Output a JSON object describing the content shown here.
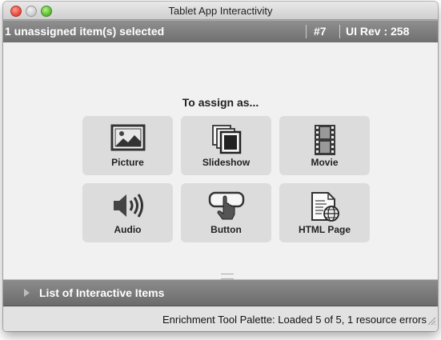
{
  "window": {
    "title": "Tablet App Interactivity"
  },
  "header": {
    "selection_text": "1 unassigned item(s) selected",
    "item_number": "#7",
    "ui_rev": "UI Rev : 258"
  },
  "assign": {
    "title": "To assign as...",
    "options": [
      {
        "label": "Picture",
        "icon": "picture-icon"
      },
      {
        "label": "Slideshow",
        "icon": "slideshow-icon"
      },
      {
        "label": "Movie",
        "icon": "movie-icon"
      },
      {
        "label": "Audio",
        "icon": "audio-icon"
      },
      {
        "label": "Button",
        "icon": "button-icon"
      },
      {
        "label": "HTML Page",
        "icon": "html-page-icon"
      }
    ]
  },
  "list_section": {
    "label": "List of Interactive Items"
  },
  "status": {
    "text": "Enrichment Tool Palette:  Loaded 5 of 5, 1 resource errors"
  },
  "colors": {
    "header_bar": "#7f7f7f",
    "tile_bg": "#dcdcdc",
    "panel_bg": "#f1f1f1",
    "close_button": "#e0443a",
    "zoom_button": "#53b52c"
  }
}
